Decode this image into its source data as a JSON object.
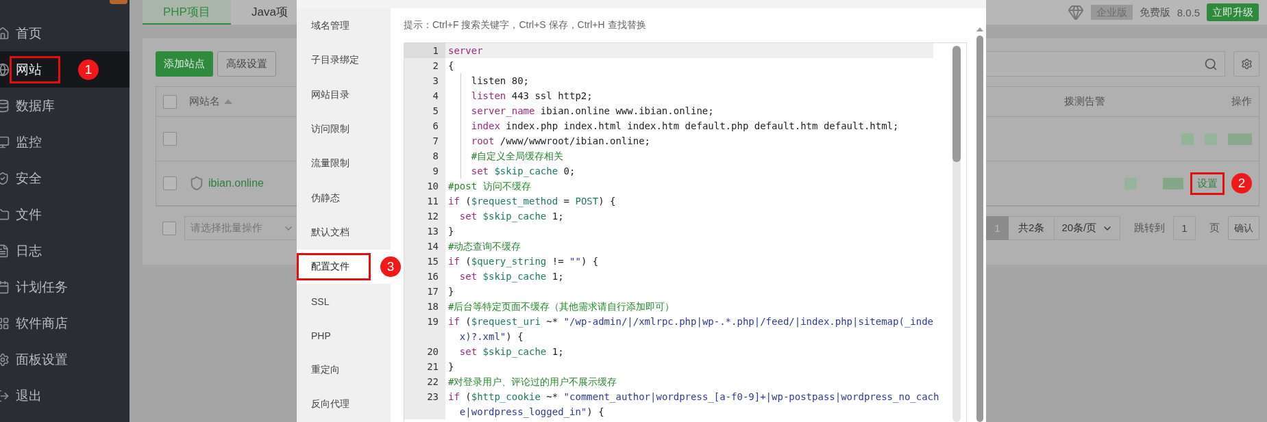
{
  "sidebar": {
    "items": [
      {
        "label": "首页",
        "selected": false
      },
      {
        "label": "网站",
        "selected": true,
        "annotation": "1"
      },
      {
        "label": "数据库",
        "selected": false
      },
      {
        "label": "监控",
        "selected": false
      },
      {
        "label": "安全",
        "selected": false
      },
      {
        "label": "文件",
        "selected": false
      },
      {
        "label": "日志",
        "selected": false
      },
      {
        "label": "计划任务",
        "selected": false
      },
      {
        "label": "软件商店",
        "selected": false
      },
      {
        "label": "面板设置",
        "selected": false
      },
      {
        "label": "退出",
        "selected": false
      }
    ]
  },
  "project_tabs": [
    {
      "label": "PHP项目",
      "selected": true
    },
    {
      "label": "Java项",
      "selected": false
    }
  ],
  "toolbar": {
    "add_button": "添加站点",
    "advanced_button": "高级设置"
  },
  "site_table": {
    "header_checked": false,
    "name_column": "网站名",
    "alert_column": "拨测告警",
    "action_column": "操作",
    "rows": [
      {
        "checked": false
      },
      {
        "checked": false,
        "name": "ibian.online",
        "action": "设置",
        "annotation": "2"
      }
    ]
  },
  "batch_select": {
    "checked": false,
    "placeholder": "请选择批量操作"
  },
  "edition": {
    "enterprise": "企业版",
    "free": "免费版",
    "version": "8.0.5",
    "upgrade": "立即升级"
  },
  "pagination": {
    "page": "1",
    "total": "共2条",
    "page_size": "20条/页",
    "jump_label": "跳转到",
    "jump_value": "1",
    "page_unit": "页",
    "confirm": "确认"
  },
  "modal": {
    "tabs": [
      {
        "label": "域名管理",
        "selected": false
      },
      {
        "label": "子目录绑定",
        "selected": false
      },
      {
        "label": "网站目录",
        "selected": false
      },
      {
        "label": "访问限制",
        "selected": false
      },
      {
        "label": "流量限制",
        "selected": false
      },
      {
        "label": "伪静态",
        "selected": false
      },
      {
        "label": "默认文档",
        "selected": false
      },
      {
        "label": "配置文件",
        "selected": true,
        "annotation": "3"
      },
      {
        "label": "SSL",
        "selected": false
      },
      {
        "label": "PHP",
        "selected": false
      },
      {
        "label": "重定向",
        "selected": false
      },
      {
        "label": "反向代理",
        "selected": false
      }
    ],
    "hint": "提示：Ctrl+F 搜索关键字，Ctrl+S 保存，Ctrl+H 查找替换",
    "code_lines": [
      {
        "number": "1",
        "active": true,
        "guide": false,
        "tokens": [
          {
            "kind": "kw",
            "text": "server"
          }
        ]
      },
      {
        "number": "2",
        "active": false,
        "guide": false,
        "tokens": [
          {
            "kind": "plain",
            "text": "{"
          }
        ]
      },
      {
        "number": "3",
        "active": false,
        "guide": true,
        "tokens": [
          {
            "kind": "plain",
            "text": "    listen 80;"
          }
        ]
      },
      {
        "number": "4",
        "active": false,
        "guide": true,
        "tokens": [
          {
            "kind": "kw",
            "text": "    listen"
          },
          {
            "kind": "plain",
            "text": " 443 ssl http2;"
          }
        ]
      },
      {
        "number": "5",
        "active": false,
        "guide": true,
        "tokens": [
          {
            "kind": "kw",
            "text": "    server_name"
          },
          {
            "kind": "plain",
            "text": " ibian.online www.ibian.online;"
          }
        ]
      },
      {
        "number": "6",
        "active": false,
        "guide": true,
        "tokens": [
          {
            "kind": "kw",
            "text": "    index"
          },
          {
            "kind": "plain",
            "text": " index.php index.html index.htm default.php default.htm default.html;"
          }
        ]
      },
      {
        "number": "7",
        "active": false,
        "guide": true,
        "tokens": [
          {
            "kind": "kw",
            "text": "    root"
          },
          {
            "kind": "plain",
            "text": " /www/wwwroot/ibian.online;"
          }
        ]
      },
      {
        "number": "8",
        "active": false,
        "guide": true,
        "tokens": [
          {
            "kind": "cmt",
            "text": "    #自定义全局缓存相关"
          }
        ]
      },
      {
        "number": "9",
        "active": false,
        "guide": true,
        "tokens": [
          {
            "kind": "kw",
            "text": "    set"
          },
          {
            "kind": "var",
            "text": " $skip_cache"
          },
          {
            "kind": "plain",
            "text": " 0;"
          }
        ]
      },
      {
        "number": "10",
        "active": false,
        "guide": false,
        "tokens": [
          {
            "kind": "cmt",
            "text": "#post 访问不缓存"
          }
        ]
      },
      {
        "number": "11",
        "active": false,
        "guide": false,
        "tokens": [
          {
            "kind": "kw",
            "text": "if"
          },
          {
            "kind": "plain",
            "text": " ("
          },
          {
            "kind": "var",
            "text": "$request_method"
          },
          {
            "kind": "plain",
            "text": " = "
          },
          {
            "kind": "var",
            "text": "POST"
          },
          {
            "kind": "plain",
            "text": ") {"
          }
        ]
      },
      {
        "number": "12",
        "active": false,
        "guide": false,
        "tokens": [
          {
            "kind": "kw",
            "text": "  set"
          },
          {
            "kind": "var",
            "text": " $skip_cache"
          },
          {
            "kind": "plain",
            "text": " 1;"
          }
        ]
      },
      {
        "number": "13",
        "active": false,
        "guide": false,
        "tokens": [
          {
            "kind": "plain",
            "text": "}"
          }
        ]
      },
      {
        "number": "14",
        "active": false,
        "guide": false,
        "tokens": [
          {
            "kind": "cmt",
            "text": "#动态查询不缓存"
          }
        ]
      },
      {
        "number": "15",
        "active": false,
        "guide": false,
        "tokens": [
          {
            "kind": "kw",
            "text": "if"
          },
          {
            "kind": "plain",
            "text": " ("
          },
          {
            "kind": "var",
            "text": "$query_string"
          },
          {
            "kind": "plain",
            "text": " != "
          },
          {
            "kind": "str",
            "text": "\"\""
          },
          {
            "kind": "plain",
            "text": ") {"
          }
        ]
      },
      {
        "number": "16",
        "active": false,
        "guide": false,
        "tokens": [
          {
            "kind": "kw",
            "text": "  set"
          },
          {
            "kind": "var",
            "text": " $skip_cache"
          },
          {
            "kind": "plain",
            "text": " 1;"
          }
        ]
      },
      {
        "number": "17",
        "active": false,
        "guide": false,
        "tokens": [
          {
            "kind": "plain",
            "text": "}"
          }
        ]
      },
      {
        "number": "18",
        "active": false,
        "guide": false,
        "tokens": [
          {
            "kind": "cmt",
            "text": "#后台等特定页面不缓存（其他需求请自行添加即可）"
          }
        ]
      },
      {
        "number": "19",
        "active": false,
        "guide": false,
        "tokens": [
          {
            "kind": "kw",
            "text": "if"
          },
          {
            "kind": "plain",
            "text": " ("
          },
          {
            "kind": "var",
            "text": "$request_uri"
          },
          {
            "kind": "plain",
            "text": " ~* "
          },
          {
            "kind": "str",
            "text": "\"/wp-admin/|/xmlrpc.php|wp-.*.php|/feed/|index.php|sitemap(_index)?.xml\""
          },
          {
            "kind": "plain",
            "text": ") {"
          }
        ]
      },
      {
        "number": "20",
        "active": false,
        "guide": false,
        "tokens": [
          {
            "kind": "kw",
            "text": "  set"
          },
          {
            "kind": "var",
            "text": " $skip_cache"
          },
          {
            "kind": "plain",
            "text": " 1;"
          }
        ]
      },
      {
        "number": "21",
        "active": false,
        "guide": false,
        "tokens": [
          {
            "kind": "plain",
            "text": "}"
          }
        ]
      },
      {
        "number": "22",
        "active": false,
        "guide": false,
        "tokens": [
          {
            "kind": "cmt",
            "text": "#对登录用户、评论过的用户不展示缓存"
          }
        ]
      },
      {
        "number": "23",
        "active": false,
        "guide": false,
        "tokens": [
          {
            "kind": "kw",
            "text": "if"
          },
          {
            "kind": "plain",
            "text": " ("
          },
          {
            "kind": "var",
            "text": "$http_cookie"
          },
          {
            "kind": "plain",
            "text": " ~* "
          },
          {
            "kind": "str",
            "text": "\"comment_author|wordpress_[a-f0-9]+|wp-postpass|wordpress_no_cache|wordpress_logged_in\""
          },
          {
            "kind": "plain",
            "text": ") {"
          }
        ]
      }
    ]
  }
}
